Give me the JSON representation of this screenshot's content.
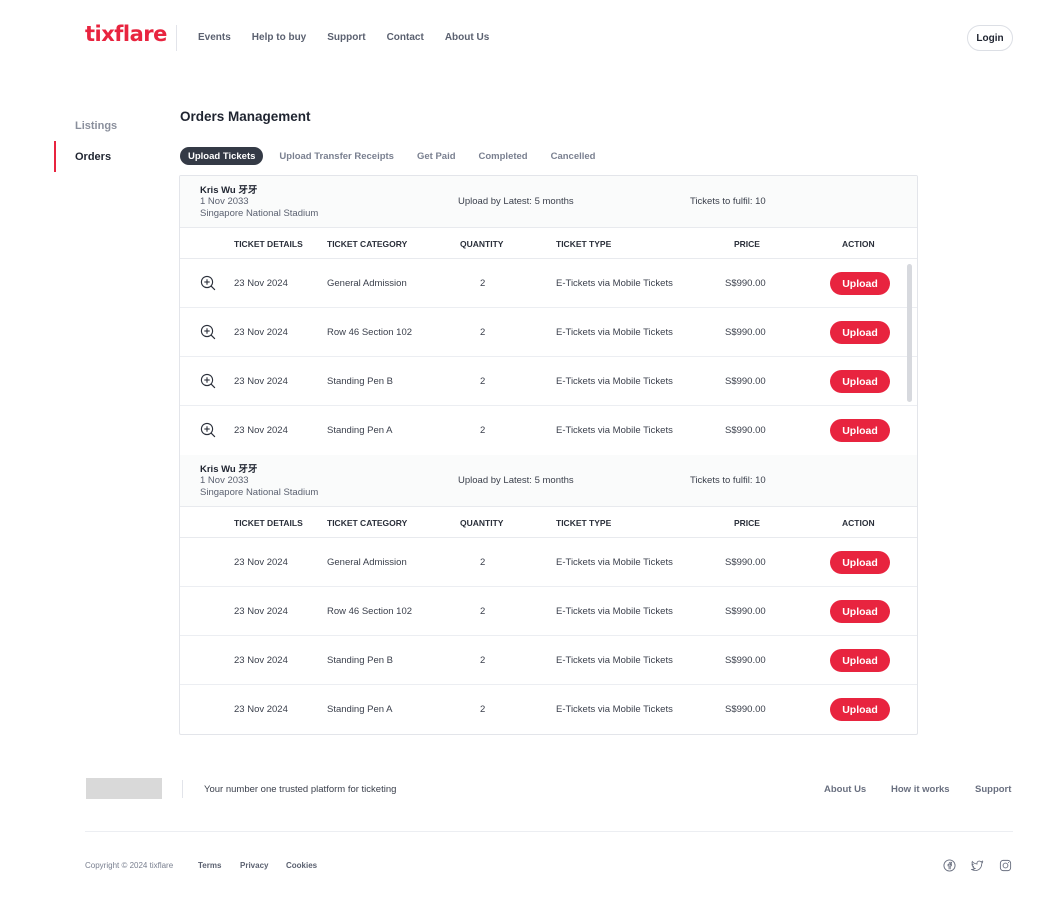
{
  "brand": {
    "name": "tixflare",
    "color": "#e8243f"
  },
  "nav": [
    "Events",
    "Help to buy",
    "Support",
    "Contact",
    "About Us"
  ],
  "header": {
    "login_label": "Login"
  },
  "sidebar": {
    "items": [
      {
        "label": "Listings",
        "active": false
      },
      {
        "label": "Orders",
        "active": true
      }
    ]
  },
  "page": {
    "title": "Orders Management"
  },
  "tabs": [
    {
      "label": "Upload Tickets",
      "active": true
    },
    {
      "label": "Upload Transfer Receipts",
      "active": false
    },
    {
      "label": "Get Paid",
      "active": false
    },
    {
      "label": "Completed",
      "active": false
    },
    {
      "label": "Cancelled",
      "active": false
    }
  ],
  "columns": [
    "TICKET DETAILS",
    "TICKET CATEGORY",
    "QUANTITY",
    "TICKET TYPE",
    "PRICE",
    "ACTION"
  ],
  "groups": [
    {
      "name": "Kris Wu 牙牙",
      "date": "1 Nov 2033",
      "venue": "Singapore National Stadium",
      "upload_by": "Upload by Latest: 5 months",
      "fulfil": "Tickets to fulfil: 10",
      "show_zoom": true,
      "rows": [
        {
          "date": "23 Nov 2024",
          "category": "General Admission",
          "quantity": "2",
          "type": "E-Tickets via Mobile Tickets",
          "price": "S$990.00",
          "action": "Upload"
        },
        {
          "date": "23 Nov 2024",
          "category": "Row 46 Section 102",
          "quantity": "2",
          "type": "E-Tickets via Mobile Tickets",
          "price": "S$990.00",
          "action": "Upload"
        },
        {
          "date": "23 Nov 2024",
          "category": "Standing Pen B",
          "quantity": "2",
          "type": "E-Tickets via Mobile Tickets",
          "price": "S$990.00",
          "action": "Upload"
        },
        {
          "date": "23 Nov 2024",
          "category": "Standing Pen A",
          "quantity": "2",
          "type": "E-Tickets via Mobile Tickets",
          "price": "S$990.00",
          "action": "Upload"
        }
      ]
    },
    {
      "name": "Kris Wu 牙牙",
      "date": "1 Nov 2033",
      "venue": "Singapore National Stadium",
      "upload_by": "Upload by Latest: 5 months",
      "fulfil": "Tickets to fulfil: 10",
      "show_zoom": false,
      "rows": [
        {
          "date": "23 Nov 2024",
          "category": "General Admission",
          "quantity": "2",
          "type": "E-Tickets via Mobile Tickets",
          "price": "S$990.00",
          "action": "Upload"
        },
        {
          "date": "23 Nov 2024",
          "category": "Row 46 Section 102",
          "quantity": "2",
          "type": "E-Tickets via Mobile Tickets",
          "price": "S$990.00",
          "action": "Upload"
        },
        {
          "date": "23 Nov 2024",
          "category": "Standing Pen B",
          "quantity": "2",
          "type": "E-Tickets via Mobile Tickets",
          "price": "S$990.00",
          "action": "Upload"
        },
        {
          "date": "23 Nov 2024",
          "category": "Standing Pen A",
          "quantity": "2",
          "type": "E-Tickets via Mobile Tickets",
          "price": "S$990.00",
          "action": "Upload"
        }
      ]
    }
  ],
  "footer": {
    "tagline": "Your number one trusted platform for ticketing",
    "links": [
      "About Us",
      "How it works",
      "Support"
    ],
    "copyright": "Copyright © 2024 tixflare",
    "legal": [
      "Terms",
      "Privacy",
      "Cookies"
    ],
    "social_icons": [
      "facebook-icon",
      "twitter-icon",
      "instagram-icon"
    ]
  }
}
